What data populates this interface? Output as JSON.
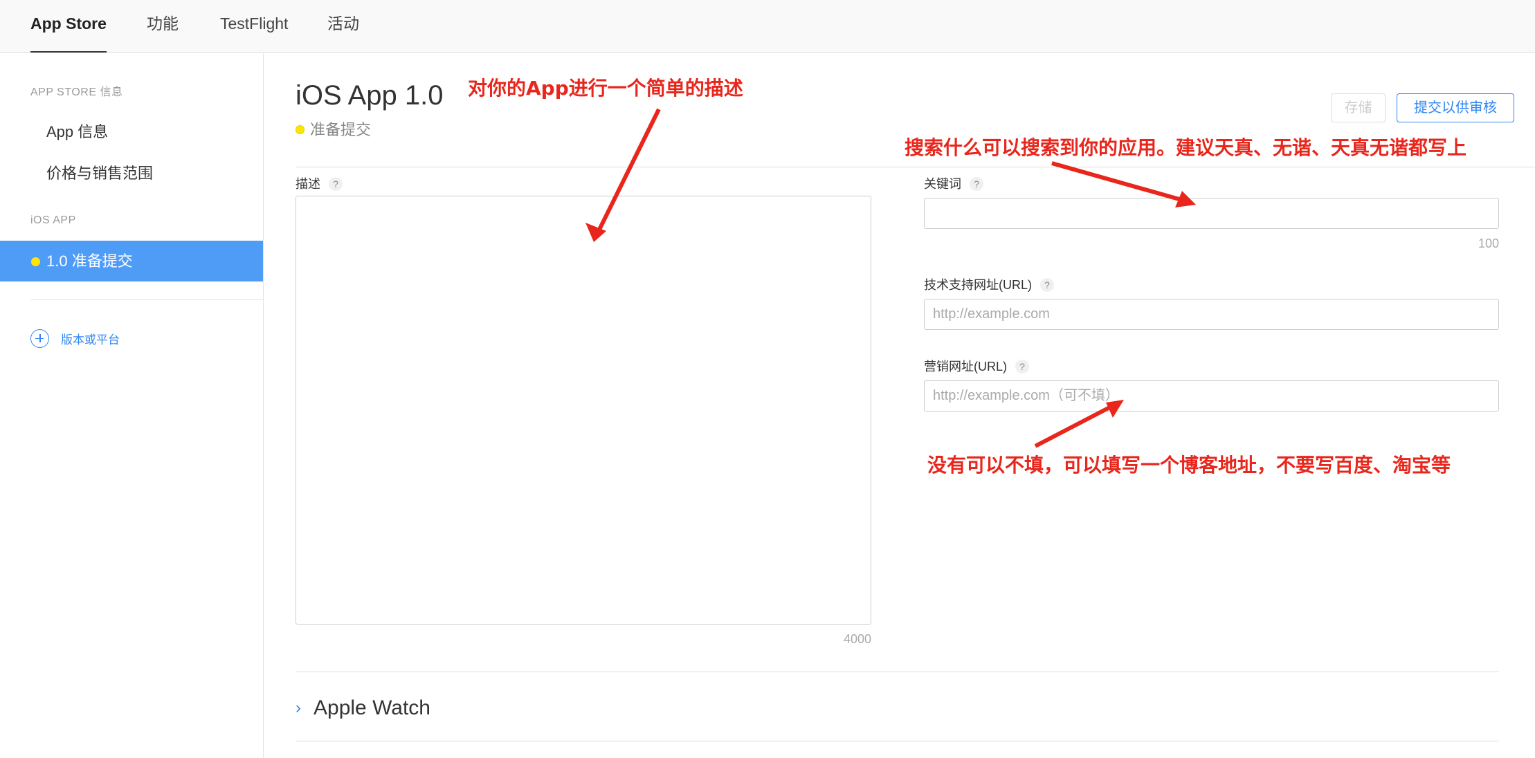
{
  "topnav": {
    "tabs": [
      {
        "label": "App Store",
        "active": true
      },
      {
        "label": "功能",
        "active": false
      },
      {
        "label": "TestFlight",
        "active": false
      },
      {
        "label": "活动",
        "active": false
      }
    ]
  },
  "sidebar": {
    "section_appstore": "APP STORE 信息",
    "item_app_info": "App 信息",
    "item_pricing": "价格与销售范围",
    "section_ios": "iOS APP",
    "active_version": "1.0 准备提交",
    "add_platform": "版本或平台"
  },
  "main": {
    "title": "iOS App 1.0",
    "status": "准备提交",
    "save_label": "存储",
    "submit_label": "提交以供审核",
    "description": {
      "label": "描述",
      "help": "?",
      "counter": "4000"
    },
    "keywords": {
      "label": "关键词",
      "help": "?",
      "counter": "100"
    },
    "support_url": {
      "label": "技术支持网址(URL)",
      "help": "?",
      "placeholder": "http://example.com"
    },
    "marketing_url": {
      "label": "营销网址(URL)",
      "help": "?",
      "placeholder": "http://example.com（可不填）"
    },
    "apple_watch": {
      "chevron": "›",
      "label": "Apple Watch"
    }
  },
  "annotations": {
    "description": "对你的App进行一个简单的描述",
    "keywords": "搜索什么可以搜索到你的应用。建议天真、无谐、天真无谐都写上",
    "marketing": "没有可以不填，可以填写一个博客地址，不要写百度、淘宝等"
  },
  "colors": {
    "accent": "#2f86f0",
    "sidebar_active": "#4f9cf7",
    "status_dot": "#ffe500",
    "annotation": "#e8261c"
  },
  "icons": {
    "help": "question-mark-icon",
    "add": "plus-circle-icon",
    "status": "status-dot-icon",
    "expand": "chevron-right-icon"
  }
}
